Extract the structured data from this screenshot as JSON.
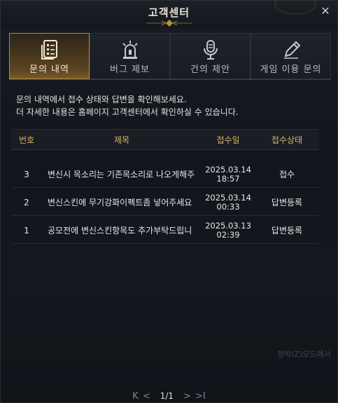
{
  "window": {
    "title": "고객센터",
    "close_icon": "close-icon"
  },
  "tabs": [
    {
      "label": "문의 내역",
      "icon": "document-list-icon",
      "active": true
    },
    {
      "label": "버그 제보",
      "icon": "siren-icon",
      "active": false
    },
    {
      "label": "건의 제안",
      "icon": "microphone-icon",
      "active": false
    },
    {
      "label": "게임 이용 문의",
      "icon": "pencil-icon",
      "active": false
    }
  ],
  "description": {
    "line1": "문의 내역에서 접수 상태와 답변을 확인해보세요.",
    "line2": "더 자세한 내용은 홈페이지 고객센터에서 확인하실 수 있습니다."
  },
  "table": {
    "headers": {
      "no": "번호",
      "subject": "제목",
      "date": "접수일",
      "status": "접수상태"
    },
    "rows": [
      {
        "no": "3",
        "subject": "변신시 목소리는 기존목소리로 나오게해주",
        "date": "2025.03.14",
        "time": "18:57",
        "status": "접수"
      },
      {
        "no": "2",
        "subject": "변신스킨에 무기강화이펙트좀 넣어주세요",
        "date": "2025.03.14",
        "time": "00:33",
        "status": "답변등록"
      },
      {
        "no": "1",
        "subject": "공모전에 변신스킨항목도 추가부탁드립니",
        "date": "2025.03.13",
        "time": "02:39",
        "status": "답변등록"
      }
    ]
  },
  "background_text": "정박(Z)모드에서",
  "pager": {
    "first": "K",
    "prev": "<",
    "info": "1/1",
    "next": ">",
    "last": ">I"
  },
  "colors": {
    "accent_gold": "#d9b46a",
    "active_tab": "#7a5b2b"
  }
}
